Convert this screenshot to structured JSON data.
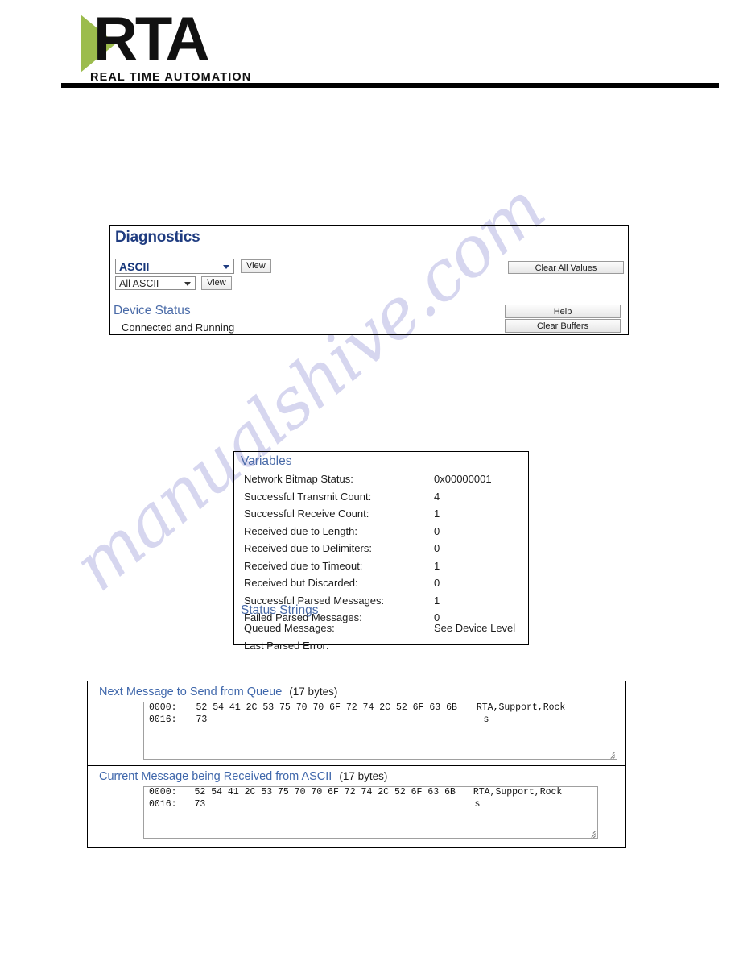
{
  "header": {
    "logo_mark": "RTA",
    "logo_tagline": "REAL TIME AUTOMATION"
  },
  "watermark": {
    "text": "manualshive.com"
  },
  "diagnostics": {
    "title": "Diagnostics",
    "port_select": {
      "value": "ASCII",
      "options": [
        "ASCII"
      ]
    },
    "port_view_button": "View",
    "filter_select": {
      "value": "All ASCII",
      "options": [
        "All ASCII"
      ]
    },
    "filter_view_button": "View",
    "clear_all_values_button": "Clear All Values",
    "help_button": "Help",
    "clear_buffers_button": "Clear Buffers",
    "device_status_title": "Device Status",
    "device_status_value": "Connected and Running"
  },
  "variables": {
    "title": "Variables",
    "rows": [
      {
        "label": "Network Bitmap Status:",
        "value": "0x00000001"
      },
      {
        "label": "Successful Transmit Count:",
        "value": "4"
      },
      {
        "label": "Successful Receive Count:",
        "value": "1"
      },
      {
        "label": "Received due to Length:",
        "value": "0"
      },
      {
        "label": "Received due to Delimiters:",
        "value": "0"
      },
      {
        "label": "Received due to Timeout:",
        "value": "1"
      },
      {
        "label": "Received but Discarded:",
        "value": "0"
      },
      {
        "label": "Successful Parsed Messages:",
        "value": "1"
      },
      {
        "label": "Failed Parsed Messages:",
        "value": "0"
      }
    ],
    "status_strings_title": "Status Strings",
    "status_rows": [
      {
        "label": "Queued Messages:",
        "value": "See Device Level"
      },
      {
        "label": "Last Parsed Error:",
        "value": ""
      }
    ]
  },
  "message_send": {
    "title": "Next Message to Send from Queue",
    "bytes_label": "(17 bytes)",
    "lines": [
      {
        "offset": "0000:",
        "bytes": "52 54 41 2C 53 75 70 70 6F 72 74 2C 52 6F 63 6B",
        "ascii": "RTA,Support,Rock"
      },
      {
        "offset": "0016:",
        "bytes": "73",
        "ascii": "s"
      }
    ]
  },
  "message_recv": {
    "title": "Current Message being Received from ASCII",
    "bytes_label": "(17 bytes)",
    "lines": [
      {
        "offset": "0000:",
        "bytes": "52 54 41 2C 53 75 70 70 6F 72 74 2C 52 6F 63 6B",
        "ascii": "RTA,Support,Rock"
      },
      {
        "offset": "0016:",
        "bytes": "73",
        "ascii": "s"
      }
    ]
  },
  "colors": {
    "heading_navy": "#1f3c80",
    "subheading_blue": "#4a6ba8",
    "logo_green": "#9cbc4d",
    "watermark": "#c9c9ea"
  }
}
